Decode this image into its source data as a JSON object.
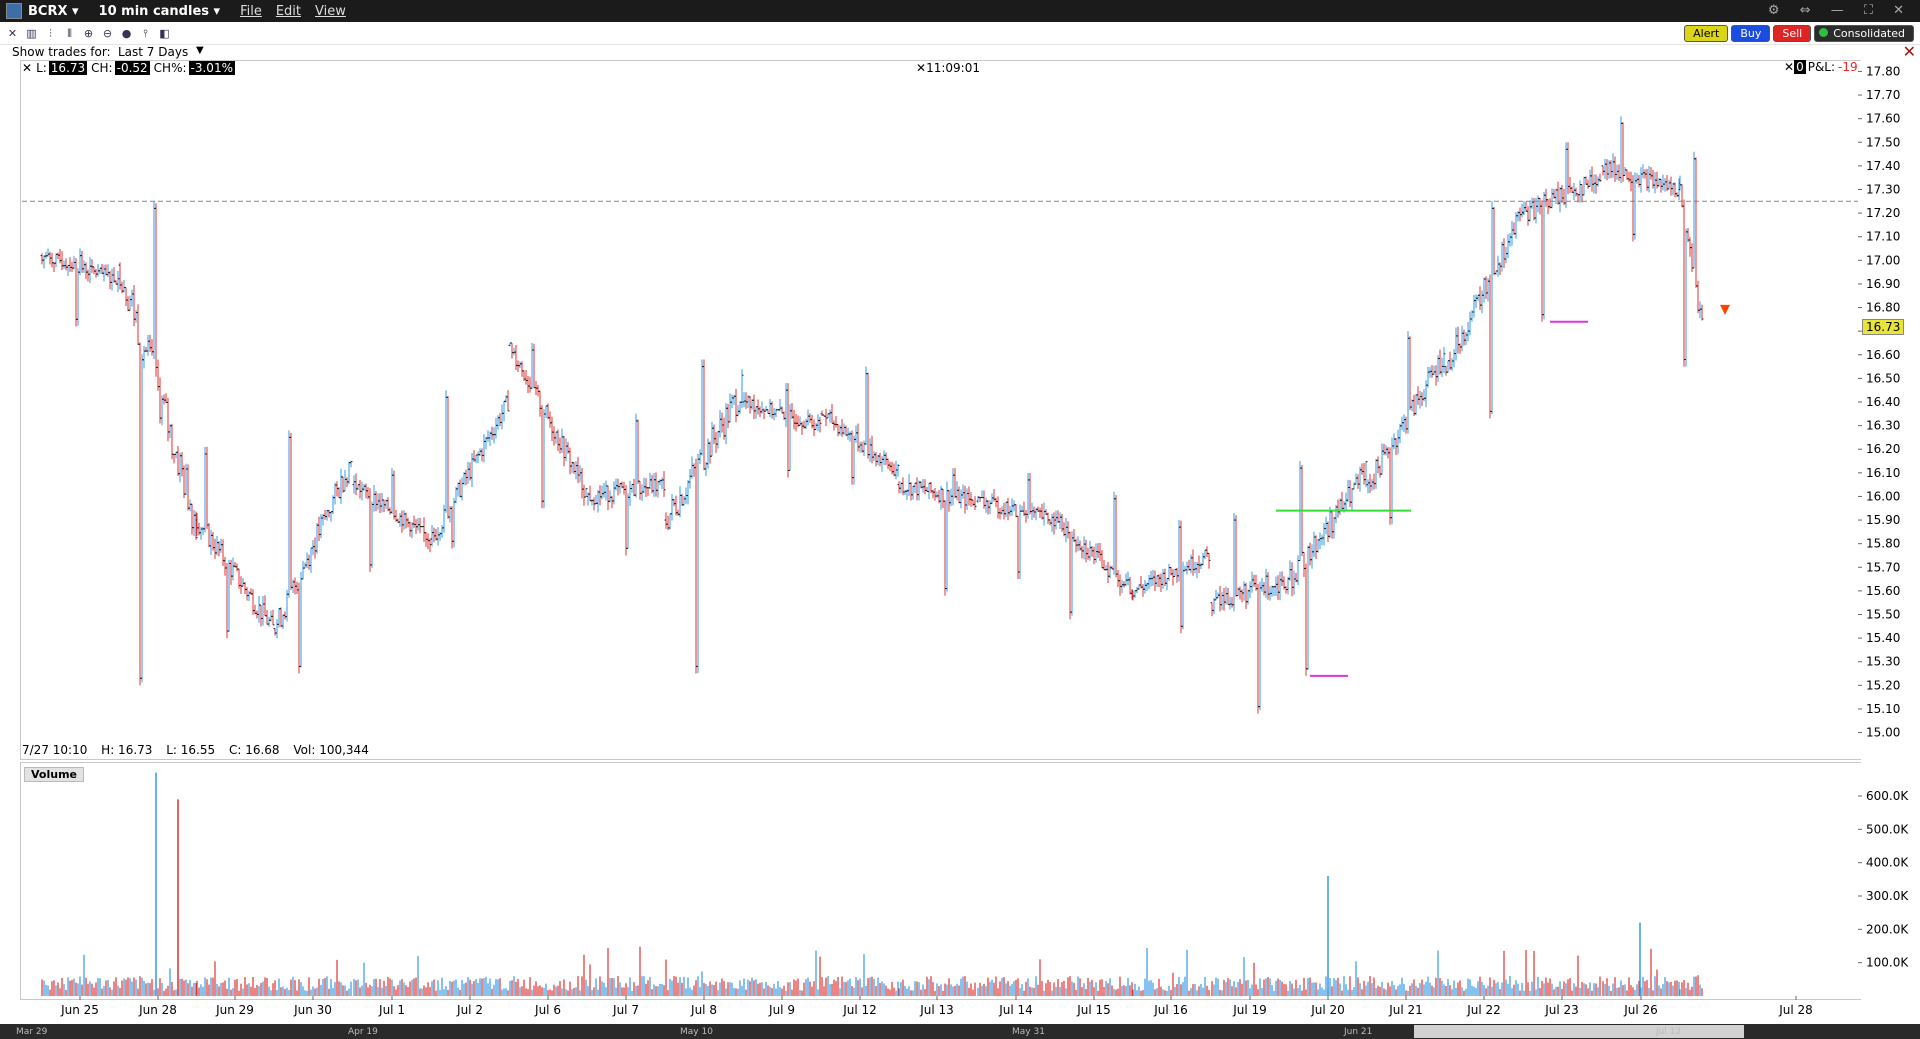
{
  "titlebar": {
    "symbol": "BCRX ▾",
    "period": "10 min candles ▾",
    "menu": [
      "File",
      "Edit",
      "View"
    ],
    "window_controls": "⚙ ⇔ — ⛶ ✕"
  },
  "toolbar": {
    "alert": "Alert",
    "buy": "Buy",
    "sell": "Sell",
    "consolidated": "Consolidated"
  },
  "trades": {
    "label": "Show trades for:",
    "value": "Last 7 Days",
    "arrow": "▼"
  },
  "price_bar": {
    "last_label": "L:",
    "last": "16.73",
    "change_label": "CH:",
    "change": "-0.52",
    "pct_label": "CH%:",
    "pct": "-3.01%",
    "time": "11:09:01",
    "pnl_box": "0",
    "pnl_label": "P&L:",
    "pnl": "-19"
  },
  "ohlc": {
    "date": "7/27 10:10",
    "high": "H: 16.73",
    "low": "L: 16.55",
    "close": "C: 16.68",
    "vol": "Vol: 100,344"
  },
  "volume_panel": {
    "label": "Volume"
  },
  "current_price_label": "16.73",
  "colors": {
    "up": "#3399e6",
    "down": "#e03232",
    "bar": "#222222",
    "green_line": "#33dd33",
    "magenta": "#dd33dd",
    "marker": "#ff4400"
  },
  "scrollbar": {
    "labels": [
      "Mar 29",
      "Apr 19",
      "May 10",
      "May 31",
      "Jun 21",
      "Jul 12"
    ]
  },
  "chart_data": {
    "type": "candlestick",
    "title": "",
    "price_axis": {
      "ylim": [
        14.96,
        17.84
      ],
      "ticks": [
        "17.80",
        "17.70",
        "17.60",
        "17.50",
        "17.40",
        "17.30",
        "17.20",
        "17.10",
        "17.00",
        "16.90",
        "16.80",
        "16.70",
        "16.60",
        "16.50",
        "16.40",
        "16.30",
        "16.20",
        "16.10",
        "16.00",
        "15.90",
        "15.80",
        "15.70",
        "15.60",
        "15.50",
        "15.40",
        "15.30",
        "15.20",
        "15.10",
        "15.00"
      ]
    },
    "volume_axis": {
      "ylim": [
        0,
        660000
      ],
      "ticks": [
        "600.0K",
        "500.0K",
        "400.0K",
        "300.0K",
        "200.0K",
        "100.0K"
      ]
    },
    "x_labels": [
      "Jun 25",
      "Jun 28",
      "Jun 29",
      "Jun 30",
      "Jul 1",
      "Jul 2",
      "Jul 6",
      "Jul 7",
      "Jul 8",
      "Jul 9",
      "Jul 12",
      "Jul 13",
      "Jul 14",
      "Jul 15",
      "Jul 16",
      "Jul 19",
      "Jul 20",
      "Jul 21",
      "Jul 22",
      "Jul 23",
      "Jul 26",
      "Jul 28"
    ],
    "reference_line": 17.25,
    "levels": [
      {
        "price": 15.94,
        "from": "Jul 19",
        "to": "Jul 21",
        "color": "green"
      },
      {
        "price": 15.24,
        "from": "Jul 20",
        "to": "Jul 20",
        "color": "magenta"
      },
      {
        "price": 16.74,
        "from": "Jul 23",
        "to": "Jul 23",
        "color": "magenta"
      }
    ],
    "daily_path": [
      {
        "day": "Jun 25",
        "open": 17.02,
        "high": 17.05,
        "low": 16.72,
        "close": 16.92
      },
      {
        "day": "Jun 28",
        "open": 16.98,
        "high": 17.25,
        "low": 15.2,
        "close": 15.9
      },
      {
        "day": "Jun 29",
        "open": 15.9,
        "high": 16.21,
        "low": 15.4,
        "close": 15.44
      },
      {
        "day": "Jun 30",
        "open": 15.44,
        "high": 16.28,
        "low": 15.25,
        "close": 16.15
      },
      {
        "day": "Jul 1",
        "open": 16.05,
        "high": 16.12,
        "low": 15.68,
        "close": 15.82
      },
      {
        "day": "Jul 2",
        "open": 15.82,
        "high": 16.45,
        "low": 15.78,
        "close": 16.4
      },
      {
        "day": "Jul 6",
        "open": 16.64,
        "high": 16.65,
        "low": 15.95,
        "close": 16.02
      },
      {
        "day": "Jul 7",
        "open": 16.0,
        "high": 16.35,
        "low": 15.75,
        "close": 16.05
      },
      {
        "day": "Jul 8",
        "open": 15.9,
        "high": 16.58,
        "low": 15.25,
        "close": 16.45
      },
      {
        "day": "Jul 9",
        "open": 16.4,
        "high": 16.48,
        "low": 16.08,
        "close": 16.3
      },
      {
        "day": "Jul 12",
        "open": 16.35,
        "high": 16.55,
        "low": 16.05,
        "close": 16.1
      },
      {
        "day": "Jul 13",
        "open": 16.05,
        "high": 16.12,
        "low": 15.58,
        "close": 15.98
      },
      {
        "day": "Jul 14",
        "open": 15.98,
        "high": 16.1,
        "low": 15.65,
        "close": 15.9
      },
      {
        "day": "Jul 15",
        "open": 15.9,
        "high": 16.02,
        "low": 15.48,
        "close": 15.6
      },
      {
        "day": "Jul 16",
        "open": 15.6,
        "high": 15.9,
        "low": 15.42,
        "close": 15.75
      },
      {
        "day": "Jul 19",
        "open": 15.55,
        "high": 15.93,
        "low": 15.08,
        "close": 15.65
      },
      {
        "day": "Jul 20",
        "open": 15.65,
        "high": 16.15,
        "low": 15.24,
        "close": 16.1
      },
      {
        "day": "Jul 21",
        "open": 16.05,
        "high": 16.7,
        "low": 15.88,
        "close": 16.6
      },
      {
        "day": "Jul 22",
        "open": 16.55,
        "high": 17.25,
        "low": 16.33,
        "close": 17.2
      },
      {
        "day": "Jul 23",
        "open": 17.2,
        "high": 17.5,
        "low": 16.74,
        "close": 17.35
      },
      {
        "day": "Jul 26",
        "open": 17.4,
        "high": 17.61,
        "low": 17.08,
        "close": 17.3
      },
      {
        "day": "Jul 27",
        "open": 17.3,
        "high": 17.46,
        "low": 16.55,
        "close": 16.73
      }
    ],
    "volume_peaks": [
      {
        "day": "Jun 28",
        "value": 670000
      },
      {
        "day": "Jun 28",
        "value": 590000
      },
      {
        "day": "Jul 20",
        "value": 360000
      },
      {
        "day": "Jul 26",
        "value": 220000
      }
    ]
  }
}
